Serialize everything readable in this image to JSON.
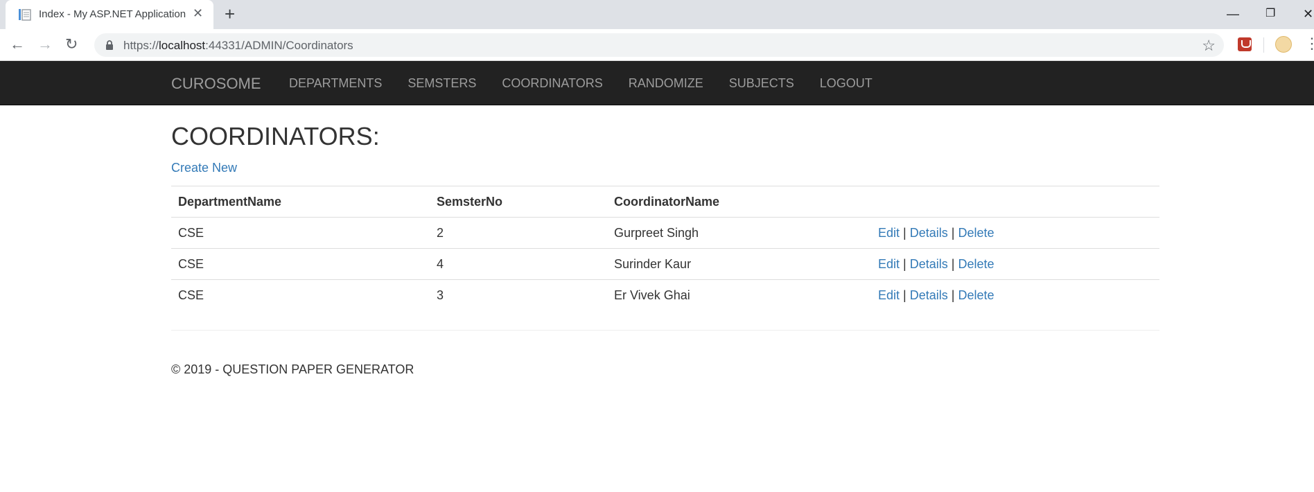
{
  "browser": {
    "tab_title": "Index - My ASP.NET Application",
    "url_prefix": "https://",
    "url_host": "localhost",
    "url_rest": ":44331/ADMIN/Coordinators"
  },
  "navbar": {
    "brand": "CUROSOME",
    "links": [
      "DEPARTMENTS",
      "SEMSTERS",
      "COORDINATORS",
      "RANDOMIZE",
      "SUBJECTS",
      "LOGOUT"
    ]
  },
  "page": {
    "title": "COORDINATORS:",
    "create_new": "Create New"
  },
  "table": {
    "headers": [
      "DepartmentName",
      "SemsterNo",
      "CoordinatorName"
    ],
    "rows": [
      {
        "department": "CSE",
        "semester": "2",
        "coordinator": "Gurpreet Singh"
      },
      {
        "department": "CSE",
        "semester": "4",
        "coordinator": "Surinder Kaur"
      },
      {
        "department": "CSE",
        "semester": "3",
        "coordinator": "Er Vivek Ghai"
      }
    ],
    "actions": {
      "edit": "Edit",
      "details": "Details",
      "delete": "Delete",
      "separator": "|"
    }
  },
  "footer": {
    "text": "© 2019 - QUESTION PAPER GENERATOR"
  }
}
